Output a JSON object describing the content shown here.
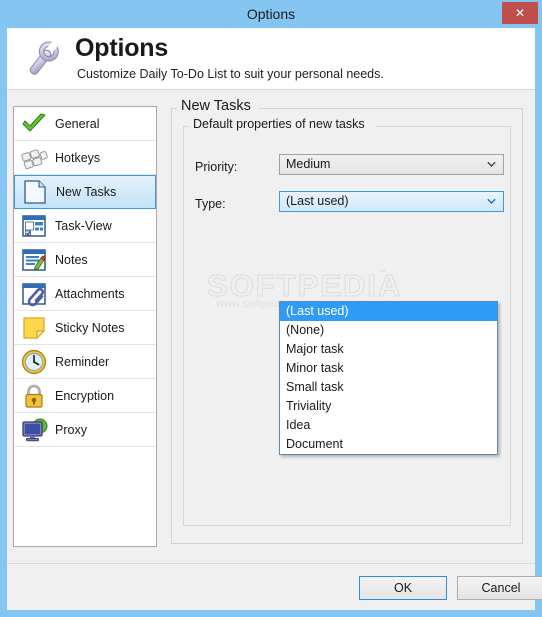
{
  "window": {
    "title": "Options",
    "close_label": "✕"
  },
  "header": {
    "title": "Options",
    "subtitle": "Customize Daily To-Do List to suit your personal needs.",
    "icon": "wrench-icon"
  },
  "sidebar": {
    "items": [
      {
        "label": "General",
        "icon": "green-check-icon",
        "selected": false
      },
      {
        "label": "Hotkeys",
        "icon": "keyboard-keys-icon",
        "selected": false
      },
      {
        "label": "New Tasks",
        "icon": "document-page-icon",
        "selected": true
      },
      {
        "label": "Task-View",
        "icon": "task-list-icon",
        "selected": false
      },
      {
        "label": "Notes",
        "icon": "notes-pencil-icon",
        "selected": false
      },
      {
        "label": "Attachments",
        "icon": "paperclip-icon",
        "selected": false
      },
      {
        "label": "Sticky Notes",
        "icon": "sticky-note-icon",
        "selected": false
      },
      {
        "label": "Reminder",
        "icon": "clock-icon",
        "selected": false
      },
      {
        "label": "Encryption",
        "icon": "padlock-icon",
        "selected": false
      },
      {
        "label": "Proxy",
        "icon": "monitor-icon",
        "selected": false
      }
    ]
  },
  "main": {
    "group_title": "New Tasks",
    "subgroup_title": "Default properties of new tasks",
    "priority": {
      "label": "Priority:",
      "value": "Medium"
    },
    "type": {
      "label": "Type:",
      "value": "(Last used)",
      "expanded": true,
      "options": [
        {
          "label": "(Last used)",
          "highlighted": true
        },
        {
          "label": "(None)",
          "highlighted": false
        },
        {
          "label": "Major task",
          "highlighted": false
        },
        {
          "label": "Minor task",
          "highlighted": false
        },
        {
          "label": "Small task",
          "highlighted": false
        },
        {
          "label": "Triviality",
          "highlighted": false
        },
        {
          "label": "Idea",
          "highlighted": false
        },
        {
          "label": "Document",
          "highlighted": false
        }
      ]
    }
  },
  "watermark": {
    "main": "SOFTPEDIA",
    "trademark": "™",
    "sub": "www.softpedia.com"
  },
  "footer": {
    "ok_label": "OK",
    "cancel_label": "Cancel"
  },
  "colors": {
    "titlebar": "#85c5f2",
    "close_button": "#c0504d",
    "accent_blue": "#2f9bf5",
    "selection_border": "#3c9bdd",
    "body_gray": "#f0f0f0"
  }
}
